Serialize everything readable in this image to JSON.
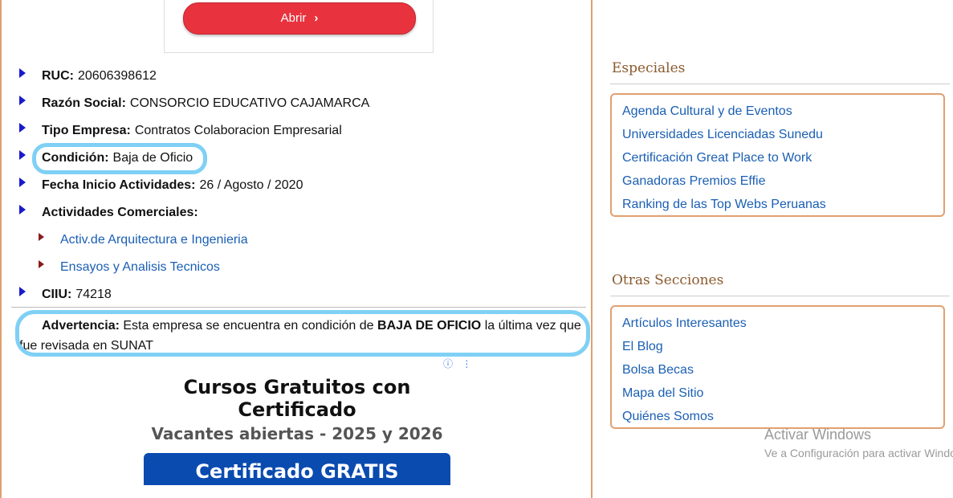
{
  "open_button": {
    "label": "Abrir",
    "chevron": "›"
  },
  "company": {
    "ruc_label": "RUC:",
    "ruc_value": "20606398612",
    "razon_label": "Razón Social:",
    "razon_value": "CONSORCIO EDUCATIVO CAJAMARCA",
    "tipo_label": "Tipo Empresa:",
    "tipo_value": "Contratos Colaboracion Empresarial",
    "condicion_label": "Condición:",
    "condicion_value": "Baja de Oficio",
    "fecha_label": "Fecha Inicio Actividades:",
    "fecha_value": "26 / Agosto / 2020",
    "actividades_label": "Actividades Comerciales:",
    "actividades": [
      "Activ.de Arquitectura e Ingenieria",
      "Ensayos y Analisis Tecnicos"
    ],
    "ciiu_label": "CIIU:",
    "ciiu_value": "74218"
  },
  "warning": {
    "label": "Advertencia:",
    "text_before": "Esta empresa se encuentra en condición de",
    "emphasis": "BAJA DE OFICIO",
    "text_after": "la última vez que fue revisada en SUNAT"
  },
  "ad": {
    "icons": "ⓘ ⋮",
    "title": "Cursos Gratuitos con Certificado",
    "subtitle": "Vacantes abiertas - 2025 y 2026",
    "button": "Certificado GRATIS"
  },
  "sidebar": {
    "especiales_title": "Especiales",
    "especiales": [
      "Agenda Cultural y de Eventos",
      "Universidades Licenciadas Sunedu",
      "Certificación Great Place to Work",
      "Ganadoras Premios Effie",
      "Ranking de las Top Webs Peruanas"
    ],
    "otras_title": "Otras Secciones",
    "otras": [
      "Artículos Interesantes",
      "El Blog",
      "Bolsa Becas",
      "Mapa del Sitio",
      "Quiénes Somos"
    ]
  },
  "watermark": {
    "line1": "Activar Windows",
    "line2": "Ve a Configuración para activar Windows."
  },
  "colors": {
    "accent_border": "#e0a070",
    "link": "#1a5fb4",
    "highlight": "#7fd0f5",
    "button": "#e8333f"
  }
}
